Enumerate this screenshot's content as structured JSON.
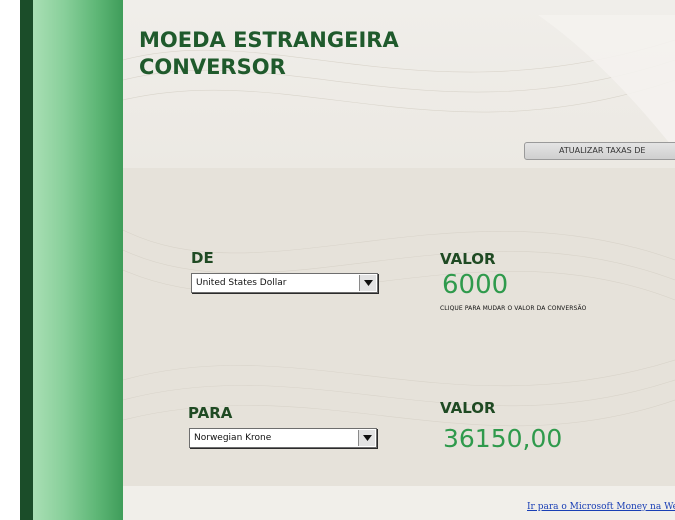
{
  "title": {
    "line1": "MOEDA ESTRANGEIRA",
    "line2": "CONVERSOR"
  },
  "refresh_button": {
    "label": "ATUALIZAR TAXAS  DE"
  },
  "from": {
    "label": "DE",
    "currency": "United States Dollar"
  },
  "to": {
    "label": "PARA",
    "currency": "Norwegian Krone"
  },
  "amount": {
    "label": "VALOR",
    "value": "6000",
    "hint": "CLIQUE PARA MUDAR O VALOR DA CONVERSÃO"
  },
  "result": {
    "label": "VALOR",
    "value": "36150,00"
  },
  "footer_link": {
    "label": "Ir para o Microsoft Money na Web"
  },
  "colors": {
    "title_green": "#1f5a2c",
    "value_green": "#2f9a4c",
    "sidebar_dark": "#1b4d29",
    "link_blue": "#1a3fb5"
  },
  "icons": {
    "dropdown": "chevron-down-icon"
  }
}
